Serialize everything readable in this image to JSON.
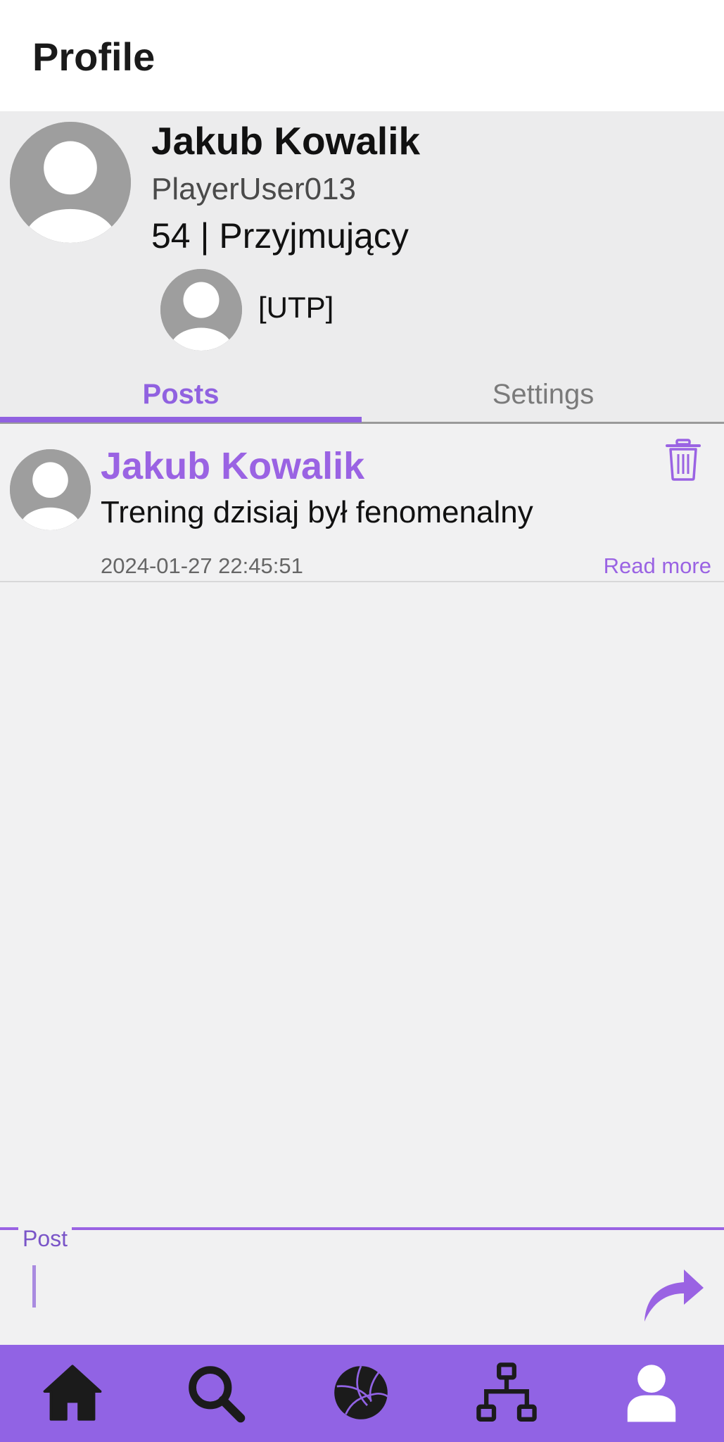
{
  "app_bar": {
    "title": "Profile"
  },
  "profile": {
    "name": "Jakub Kowalik",
    "username": "PlayerUser013",
    "meta": "54 | Przyjmujący",
    "team": "[UTP]"
  },
  "tabs": [
    {
      "label": "Posts",
      "active": true
    },
    {
      "label": "Settings",
      "active": false
    }
  ],
  "posts": [
    {
      "author": "Jakub Kowalik",
      "text": "Trening dzisiaj był fenomenalny",
      "date": "2024-01-27 22:45:51",
      "read_more": "Read more"
    }
  ],
  "composer": {
    "label": "Post",
    "value": ""
  },
  "bottom_nav": [
    {
      "icon": "home-icon"
    },
    {
      "icon": "search-icon"
    },
    {
      "icon": "volleyball-icon"
    },
    {
      "icon": "hierarchy-icon"
    },
    {
      "icon": "user-icon",
      "active": true
    }
  ],
  "colors": {
    "accent": "#9061e0",
    "nav_background": "#9163e4",
    "avatar_gray": "#9e9e9e"
  }
}
